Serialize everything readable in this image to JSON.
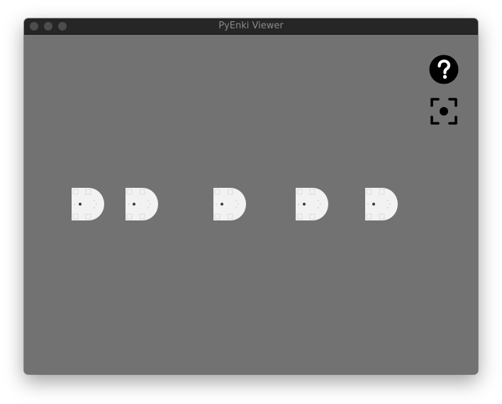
{
  "window": {
    "title": "PyEnki Viewer",
    "controls": [
      "close",
      "minimize",
      "zoom"
    ]
  },
  "toolbar": {
    "help_icon": "question-circle-icon",
    "focus_icon": "focus-center-icon"
  },
  "scene": {
    "background_color": "#727272",
    "robot_color": "#f2f2f2",
    "robot_count": 5
  }
}
